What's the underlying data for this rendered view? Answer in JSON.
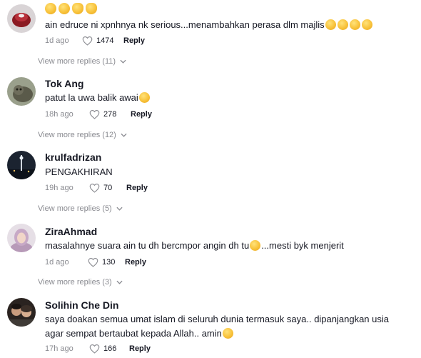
{
  "comments": [
    {
      "username": "",
      "username_emojis": [
        "shushing-face-emoji",
        "shushing-face-emoji",
        "ok-hand-emoji",
        "ok-hand-emoji"
      ],
      "text": "ain edruce ni xpnhnya nk serious...menambahkan perasa dlm majlis",
      "text_emojis": [
        "joy-emoji",
        "joy-emoji",
        "joy-emoji",
        "joy-emoji"
      ],
      "time": "1d ago",
      "likes": "1474",
      "reply_label": "Reply",
      "view_more": "View more replies (11)"
    },
    {
      "username": "Tok Ang",
      "text": "patut la uwa balik awai",
      "text_emojis": [
        "sweat-smile-emoji"
      ],
      "time": "18h ago",
      "likes": "278",
      "reply_label": "Reply",
      "view_more": "View more replies (12)"
    },
    {
      "username": "krulfadrizan",
      "text": "PENGAKHIRAN",
      "time": "19h ago",
      "likes": "70",
      "reply_label": "Reply",
      "view_more": "View more replies (5)"
    },
    {
      "username": "ZiraAhmad",
      "text_before": "masalahnye suara ain tu dh bercmpor angin dh tu",
      "text_emojis": [
        "joy-emoji"
      ],
      "text_after": "...mesti byk menjerit",
      "time": "1d ago",
      "likes": "130",
      "reply_label": "Reply",
      "view_more": "View more replies (3)"
    },
    {
      "username": "Solihin Che Din",
      "text_line1": "saya doakan semua umat islam di seluruh dunia termasuk saya.. dipanjangkan usia",
      "text_line2": "agar sempat bertaubat kepada Allah.. amin",
      "text_emojis": [
        "smiling-face-with-hearts-emoji"
      ],
      "time": "17h ago",
      "likes": "166",
      "reply_label": "Reply"
    }
  ],
  "colors": {
    "text": "#161823",
    "muted": "#8a8b91"
  }
}
